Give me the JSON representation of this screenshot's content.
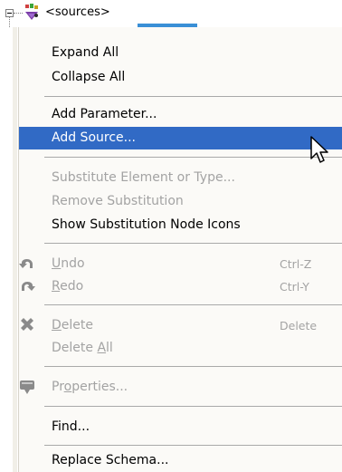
{
  "tree": {
    "node_label": "<sources>"
  },
  "menu": {
    "expand_all": "Expand All",
    "collapse_all": "Collapse All",
    "add_parameter": "Add Parameter...",
    "add_source": "Add Source...",
    "substitute": "Substitute Element or Type...",
    "remove_substitution": "Remove Substitution",
    "show_substitution_icons": "Show Substitution Node Icons",
    "undo": {
      "pre": "",
      "key": "U",
      "post": "ndo",
      "shortcut": "Ctrl-Z"
    },
    "redo": {
      "pre": "",
      "key": "R",
      "post": "edo",
      "shortcut": "Ctrl-Y"
    },
    "delete": {
      "pre": "",
      "key": "D",
      "post": "elete",
      "shortcut": "Delete"
    },
    "delete_all": {
      "pre": "Delete ",
      "key": "A",
      "post": "ll"
    },
    "properties": {
      "pre": "Pr",
      "key": "o",
      "post": "perties..."
    },
    "find": "Find...",
    "replace_schema": "Replace Schema..."
  },
  "icons": {
    "node": "schema-sources-icon",
    "undo": "undo-arrow-icon",
    "redo": "redo-arrow-icon",
    "delete": "delete-x-icon",
    "properties": "properties-icon",
    "cursor": "mouse-pointer-icon"
  },
  "colors": {
    "highlight": "#316ac5",
    "disabled_text": "#a3a3a3",
    "menu_bg": "#fbfaf7"
  }
}
